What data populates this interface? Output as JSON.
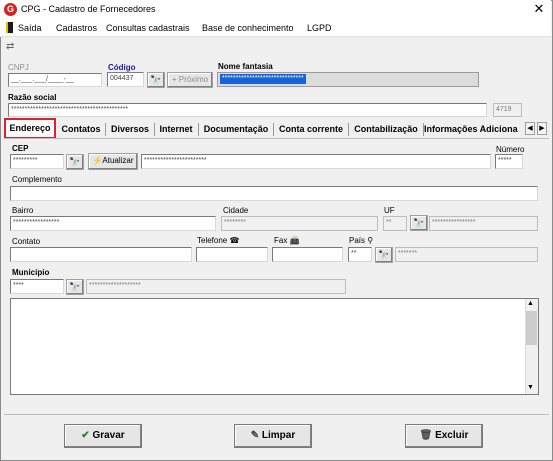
{
  "window": {
    "title": "CPG - Cadastro de Fornecedores",
    "app_icon": "G",
    "close_glyph": "✕"
  },
  "menu": [
    "Saída",
    "Cadastros",
    "Consultas cadastrais",
    "Base de conhecimento",
    "LGPD"
  ],
  "header": {
    "cnpj_label": "CNPJ",
    "cnpj_value": "__.___.___/____-__",
    "codigo_label": "Código",
    "codigo_value": "004437",
    "proximo_label": "Próximo",
    "nome_fantasia_label": "Nome fantasia",
    "nome_fantasia_value": "******************************",
    "razao_social_label": "Razão social",
    "razao_social_value": "*******************************************",
    "razao_code": "4719"
  },
  "tabs": [
    "Endereço",
    "Contatos",
    "Diversos",
    "Internet",
    "Documentação",
    "Conta corrente",
    "Contabilização",
    "Informações Adiciona"
  ],
  "active_tab": "Endereço",
  "address": {
    "cep_label": "CEP",
    "cep_value": "*********",
    "atualizar_label": "Atualizar",
    "logradouro_value": "***********************",
    "numero_label": "Número",
    "numero_value": "*****",
    "complemento_label": "Complemento",
    "complemento_value": "",
    "bairro_label": "Bairro",
    "bairro_value": "*****************",
    "cidade_label": "Cidade",
    "cidade_value": "********",
    "uf_label": "UF",
    "uf_value": "**",
    "uf_name_value": "****************",
    "contato_label": "Contato",
    "contato_value": "",
    "telefone_label": "Telefone",
    "telefone_value": "",
    "fax_label": "Fax",
    "fax_value": "",
    "pais_label": "País",
    "pais_value": "**",
    "pais_name_value": "*******",
    "municipio_label": "Município",
    "municipio_value": "****",
    "municipio_name_value": "*******************"
  },
  "buttons": {
    "gravar": "Gravar",
    "limpar": "Limpar",
    "excluir": "Excluir"
  },
  "colors": {
    "accent_red": "#d9232b",
    "selection_blue": "#1565d8",
    "code_label_blue": "#1a1aa0"
  }
}
